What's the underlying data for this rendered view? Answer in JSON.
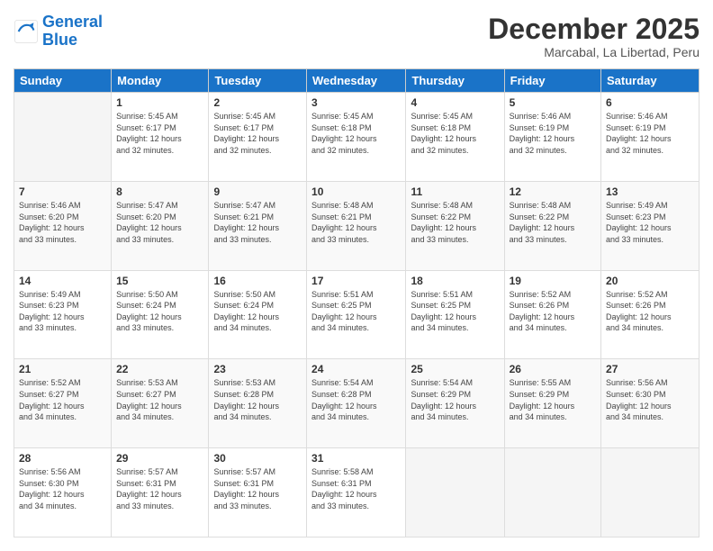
{
  "logo": {
    "line1": "General",
    "line2": "Blue"
  },
  "header": {
    "month": "December 2025",
    "location": "Marcabal, La Libertad, Peru"
  },
  "days_of_week": [
    "Sunday",
    "Monday",
    "Tuesday",
    "Wednesday",
    "Thursday",
    "Friday",
    "Saturday"
  ],
  "weeks": [
    [
      {
        "day": "",
        "info": ""
      },
      {
        "day": "1",
        "info": "Sunrise: 5:45 AM\nSunset: 6:17 PM\nDaylight: 12 hours\nand 32 minutes."
      },
      {
        "day": "2",
        "info": "Sunrise: 5:45 AM\nSunset: 6:17 PM\nDaylight: 12 hours\nand 32 minutes."
      },
      {
        "day": "3",
        "info": "Sunrise: 5:45 AM\nSunset: 6:18 PM\nDaylight: 12 hours\nand 32 minutes."
      },
      {
        "day": "4",
        "info": "Sunrise: 5:45 AM\nSunset: 6:18 PM\nDaylight: 12 hours\nand 32 minutes."
      },
      {
        "day": "5",
        "info": "Sunrise: 5:46 AM\nSunset: 6:19 PM\nDaylight: 12 hours\nand 32 minutes."
      },
      {
        "day": "6",
        "info": "Sunrise: 5:46 AM\nSunset: 6:19 PM\nDaylight: 12 hours\nand 32 minutes."
      }
    ],
    [
      {
        "day": "7",
        "info": "Sunrise: 5:46 AM\nSunset: 6:20 PM\nDaylight: 12 hours\nand 33 minutes."
      },
      {
        "day": "8",
        "info": "Sunrise: 5:47 AM\nSunset: 6:20 PM\nDaylight: 12 hours\nand 33 minutes."
      },
      {
        "day": "9",
        "info": "Sunrise: 5:47 AM\nSunset: 6:21 PM\nDaylight: 12 hours\nand 33 minutes."
      },
      {
        "day": "10",
        "info": "Sunrise: 5:48 AM\nSunset: 6:21 PM\nDaylight: 12 hours\nand 33 minutes."
      },
      {
        "day": "11",
        "info": "Sunrise: 5:48 AM\nSunset: 6:22 PM\nDaylight: 12 hours\nand 33 minutes."
      },
      {
        "day": "12",
        "info": "Sunrise: 5:48 AM\nSunset: 6:22 PM\nDaylight: 12 hours\nand 33 minutes."
      },
      {
        "day": "13",
        "info": "Sunrise: 5:49 AM\nSunset: 6:23 PM\nDaylight: 12 hours\nand 33 minutes."
      }
    ],
    [
      {
        "day": "14",
        "info": "Sunrise: 5:49 AM\nSunset: 6:23 PM\nDaylight: 12 hours\nand 33 minutes."
      },
      {
        "day": "15",
        "info": "Sunrise: 5:50 AM\nSunset: 6:24 PM\nDaylight: 12 hours\nand 33 minutes."
      },
      {
        "day": "16",
        "info": "Sunrise: 5:50 AM\nSunset: 6:24 PM\nDaylight: 12 hours\nand 34 minutes."
      },
      {
        "day": "17",
        "info": "Sunrise: 5:51 AM\nSunset: 6:25 PM\nDaylight: 12 hours\nand 34 minutes."
      },
      {
        "day": "18",
        "info": "Sunrise: 5:51 AM\nSunset: 6:25 PM\nDaylight: 12 hours\nand 34 minutes."
      },
      {
        "day": "19",
        "info": "Sunrise: 5:52 AM\nSunset: 6:26 PM\nDaylight: 12 hours\nand 34 minutes."
      },
      {
        "day": "20",
        "info": "Sunrise: 5:52 AM\nSunset: 6:26 PM\nDaylight: 12 hours\nand 34 minutes."
      }
    ],
    [
      {
        "day": "21",
        "info": "Sunrise: 5:52 AM\nSunset: 6:27 PM\nDaylight: 12 hours\nand 34 minutes."
      },
      {
        "day": "22",
        "info": "Sunrise: 5:53 AM\nSunset: 6:27 PM\nDaylight: 12 hours\nand 34 minutes."
      },
      {
        "day": "23",
        "info": "Sunrise: 5:53 AM\nSunset: 6:28 PM\nDaylight: 12 hours\nand 34 minutes."
      },
      {
        "day": "24",
        "info": "Sunrise: 5:54 AM\nSunset: 6:28 PM\nDaylight: 12 hours\nand 34 minutes."
      },
      {
        "day": "25",
        "info": "Sunrise: 5:54 AM\nSunset: 6:29 PM\nDaylight: 12 hours\nand 34 minutes."
      },
      {
        "day": "26",
        "info": "Sunrise: 5:55 AM\nSunset: 6:29 PM\nDaylight: 12 hours\nand 34 minutes."
      },
      {
        "day": "27",
        "info": "Sunrise: 5:56 AM\nSunset: 6:30 PM\nDaylight: 12 hours\nand 34 minutes."
      }
    ],
    [
      {
        "day": "28",
        "info": "Sunrise: 5:56 AM\nSunset: 6:30 PM\nDaylight: 12 hours\nand 34 minutes."
      },
      {
        "day": "29",
        "info": "Sunrise: 5:57 AM\nSunset: 6:31 PM\nDaylight: 12 hours\nand 33 minutes."
      },
      {
        "day": "30",
        "info": "Sunrise: 5:57 AM\nSunset: 6:31 PM\nDaylight: 12 hours\nand 33 minutes."
      },
      {
        "day": "31",
        "info": "Sunrise: 5:58 AM\nSunset: 6:31 PM\nDaylight: 12 hours\nand 33 minutes."
      },
      {
        "day": "",
        "info": ""
      },
      {
        "day": "",
        "info": ""
      },
      {
        "day": "",
        "info": ""
      }
    ]
  ]
}
